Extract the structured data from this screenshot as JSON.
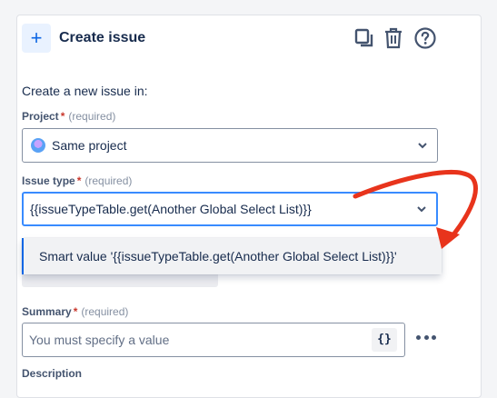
{
  "header": {
    "add_icon": "plus-icon",
    "title": "Create issue",
    "icons": [
      "copy-icon",
      "trash-icon",
      "help-icon"
    ]
  },
  "intro": "Create a new issue in:",
  "project": {
    "label": "Project",
    "required_mark": "*",
    "required_text": "(required)",
    "value": "Same project",
    "icon": "project-avatar-icon"
  },
  "issue_type": {
    "label": "Issue type",
    "required_mark": "*",
    "required_text": "(required)",
    "value": "{{issueTypeTable.get(Another Global Select List)}}"
  },
  "dropdown": {
    "options": [
      "Smart value '{{issueTypeTable.get(Another Global Select List)}}'"
    ]
  },
  "summary": {
    "label": "Summary",
    "required_mark": "*",
    "required_text": "(required)",
    "placeholder": "You must specify a value",
    "smart_value_button": "{}"
  },
  "description": {
    "label": "Description"
  },
  "colors": {
    "accent": "#0c66e4",
    "focus_border": "#388bff",
    "required": "#c9372c",
    "annotation_arrow": "#e8341c"
  }
}
